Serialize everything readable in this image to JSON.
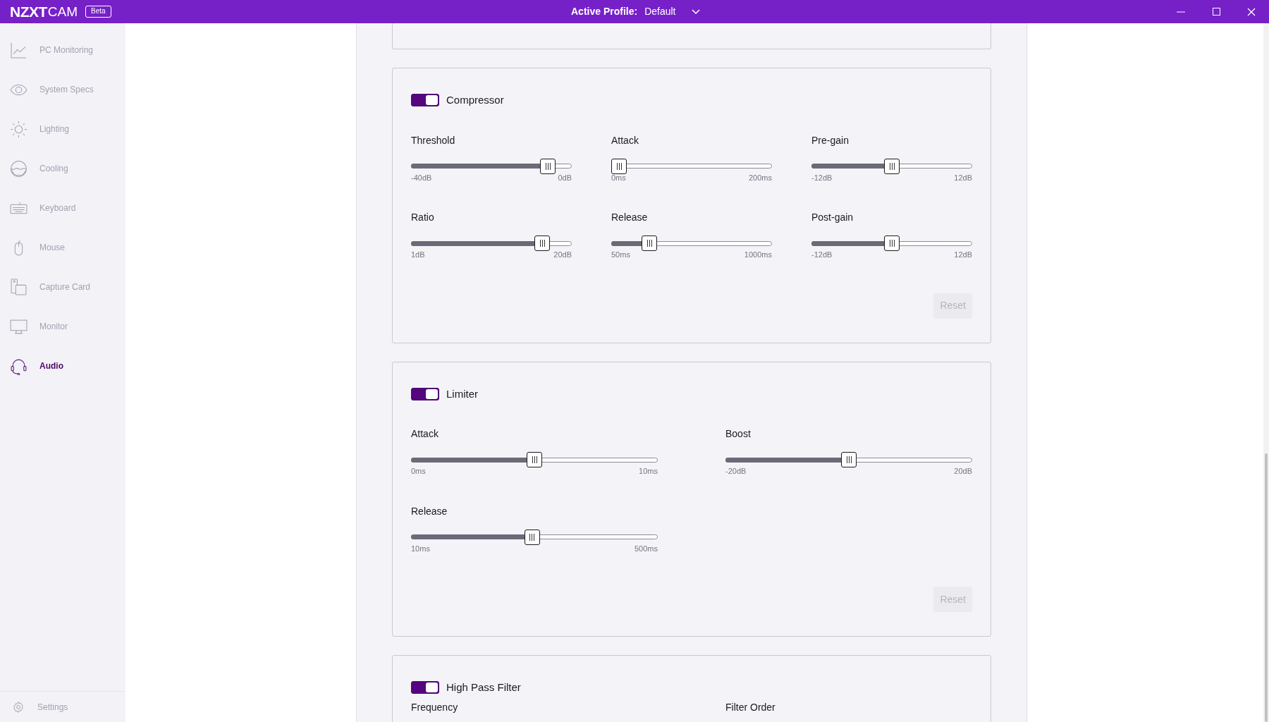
{
  "title_bar": {
    "logo": "NZXT",
    "app_name": "CAM",
    "badge": "Beta",
    "profile_label": "Active Profile:",
    "profile_value": "Default"
  },
  "sidebar": {
    "items": [
      {
        "label": "PC Monitoring",
        "selected": false
      },
      {
        "label": "System Specs",
        "selected": false
      },
      {
        "label": "Lighting",
        "selected": false
      },
      {
        "label": "Cooling",
        "selected": false
      },
      {
        "label": "Keyboard",
        "selected": false
      },
      {
        "label": "Mouse",
        "selected": false
      },
      {
        "label": "Capture Card",
        "selected": false
      },
      {
        "label": "Monitor",
        "selected": false
      },
      {
        "label": "Audio",
        "selected": true
      }
    ],
    "settings": "Settings"
  },
  "panels": [
    {
      "title": "Compressor",
      "on": true,
      "kind": "three-column",
      "sliders": [
        {
          "label": "Threshold",
          "min": "-40dB",
          "max": "0dB",
          "level": 0.89
        },
        {
          "label": "Attack",
          "min": "0ms",
          "max": "200ms",
          "level": 0
        },
        {
          "label": "Pre-gain",
          "min": "-12dB",
          "max": "12dB",
          "level": 0.5
        },
        {
          "label": "Ratio",
          "min": "1dB",
          "max": "20dB",
          "level": 0.85
        },
        {
          "label": "Release",
          "min": "50ms",
          "max": "1000ms",
          "level": 0.21
        },
        {
          "label": "Post-gain",
          "min": "-12dB",
          "max": "12dB",
          "level": 0.5
        }
      ],
      "reset": {
        "label": "Reset",
        "disabled": true
      }
    },
    {
      "title": "Limiter",
      "on": true,
      "kind": "two-column",
      "sliders": [
        {
          "label": "Attack",
          "min": "0ms",
          "max": "10ms",
          "level": 0.5
        },
        {
          "label": "Boost",
          "min": "-20dB",
          "max": "20dB",
          "level": 0.5
        },
        {
          "label": "Release",
          "min": "10ms",
          "max": "500ms",
          "level": 0.49
        }
      ],
      "reset": {
        "label": "Reset",
        "disabled": true
      }
    },
    {
      "title": "High Pass Filter",
      "on": true,
      "kind": "two-column",
      "sliders": [
        {
          "label": "Frequency"
        },
        {
          "label": "Filter Order"
        }
      ]
    }
  ]
}
